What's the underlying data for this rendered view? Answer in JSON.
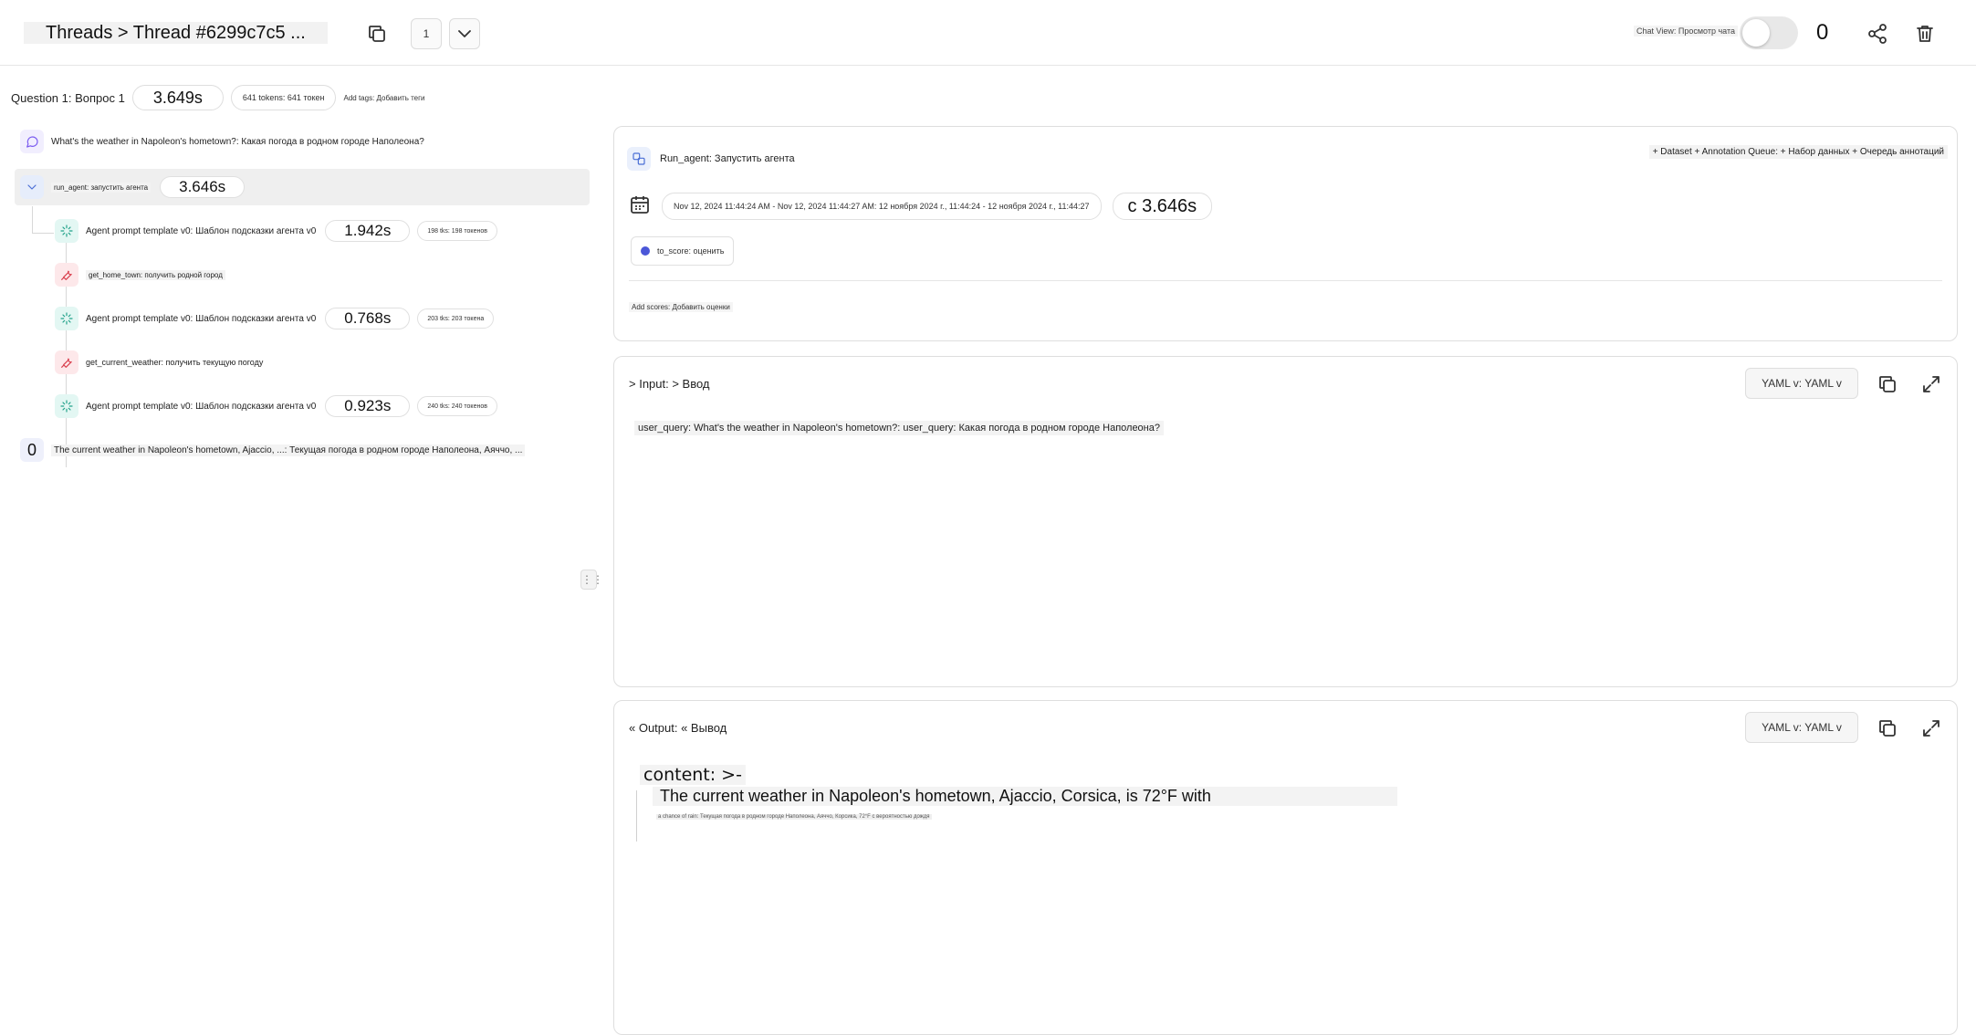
{
  "header": {
    "breadcrumb": "Threads > Thread #6299c7c5 ...",
    "page_number": "1",
    "chat_view_label": "Chat View: Просмотр чата",
    "count": "0"
  },
  "summary": {
    "question": "Question 1: Вопрос 1",
    "latency": "3.649s",
    "tokens": "641 tokens: 641 токен",
    "add_tags": "Add tags: Добавить теги"
  },
  "tree": {
    "user_message": "What's the weather in Napoleon's hometown?: Какая погода в родном городе Наполеона?",
    "run_agent": {
      "label": "run_agent: запустить агента",
      "latency": "3.646s"
    },
    "steps": [
      {
        "label": "Agent prompt template v0: Шаблон подсказки агента v0",
        "latency": "1.942s",
        "tokens": "198 tks: 198 токенов"
      },
      {
        "label": "get_home_town: получить родной город"
      },
      {
        "label": "Agent prompt template v0: Шаблон подсказки агента v0",
        "latency": "0.768s",
        "tokens": "203 tks: 203 токена"
      },
      {
        "label": "get_current_weather: получить текущую погоду"
      },
      {
        "label": "Agent prompt template v0: Шаблон подсказки агента v0",
        "latency": "0.923s",
        "tokens": "240 tks: 240 токенов"
      }
    ],
    "output_message": "The current weather in Napoleon's hometown, Ajaccio, ...: Текущая погода в родном городе Наполеона, Аяччо, ...",
    "output_count": "0"
  },
  "run_card": {
    "name": "Run_agent: Запустить агента",
    "dataset_button": "+ Dataset + Annotation Queue: + Набор данных + Очередь аннотаций",
    "date_range": "Nov 12, 2024 11:44:24 AM - Nov 12, 2024 11:44:27 AM: 12 ноября 2024 г., 11:44:24 - 12 ноября 2024 г., 11:44:27",
    "latency": "с 3.646s",
    "score_label": "to_score: оценить",
    "add_scores": "Add scores: Добавить оценки"
  },
  "input_card": {
    "title": "> Input: > Ввод",
    "format": "YAML v: YAML v",
    "value": "user_query: What's the weather in Napoleon's hometown?: user_query: Какая погода в родном городе Наполеона?"
  },
  "output_card": {
    "title": "« Output: « Вывод",
    "format": "YAML v: YAML v",
    "line1": "content: >-",
    "line2": "The current weather in Napoleon's hometown, Ajaccio, Corsica, is 72°F with",
    "line3": "a chance of rain: Текущая погода в родном городе Наполеона, Аяччо, Корсика, 72°F с вероятностью дождя"
  }
}
